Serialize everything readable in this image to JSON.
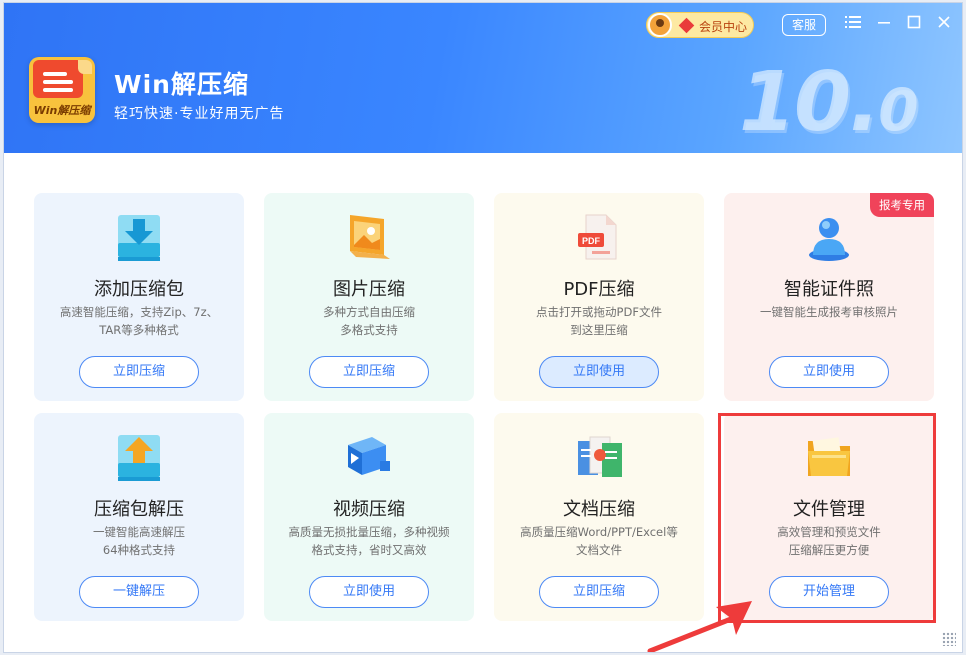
{
  "app": {
    "title": "Win解压缩",
    "subtitle": "轻巧快速·专业好用无广告",
    "logo_text": "Win解压缩",
    "version_major": "10.",
    "version_minor": "0"
  },
  "topbar": {
    "vip_label": "会员中心",
    "service_label": "客服",
    "menu_icon": "menu-icon",
    "minimize_icon": "minimize-icon",
    "maximize_icon": "maximize-icon",
    "close_icon": "close-icon"
  },
  "cards": [
    {
      "title": "添加压缩包",
      "desc1": "高速智能压缩，支持Zip、7z、",
      "desc2": "TAR等多种格式",
      "button": "立即压缩",
      "icon": "download-box-icon",
      "theme": "blue"
    },
    {
      "title": "图片压缩",
      "desc1": "多种方式自由压缩",
      "desc2": "多格式支持",
      "button": "立即压缩",
      "icon": "image-icon",
      "theme": "green"
    },
    {
      "title": "PDF压缩",
      "desc1": "点击打开或拖动PDF文件",
      "desc2": "到这里压缩",
      "button": "立即使用",
      "icon": "pdf-icon",
      "theme": "yellow"
    },
    {
      "title": "智能证件照",
      "desc1": "一键智能生成报考审核照片",
      "desc2": "",
      "button": "立即使用",
      "icon": "id-photo-icon",
      "theme": "pink",
      "tag": "报考专用"
    },
    {
      "title": "压缩包解压",
      "desc1": "一键智能高速解压",
      "desc2": "64种格式支持",
      "button": "一键解压",
      "icon": "upload-box-icon",
      "theme": "blue"
    },
    {
      "title": "视频压缩",
      "desc1": "高质量无损批量压缩，多种视频",
      "desc2": "格式支持，省时又高效",
      "button": "立即使用",
      "icon": "video-icon",
      "theme": "green"
    },
    {
      "title": "文档压缩",
      "desc1": "高质量压缩Word/PPT/Excel等",
      "desc2": "文档文件",
      "button": "立即压缩",
      "icon": "document-icon",
      "theme": "yellow"
    },
    {
      "title": "文件管理",
      "desc1": "高效管理和预览文件",
      "desc2": "压缩解压更方便",
      "button": "开始管理",
      "icon": "folder-icon",
      "theme": "pink"
    }
  ],
  "colors": {
    "accent": "#3478f6",
    "header_start": "#2f74f5",
    "highlight": "#ee3b3b",
    "tag": "#f0435a"
  }
}
